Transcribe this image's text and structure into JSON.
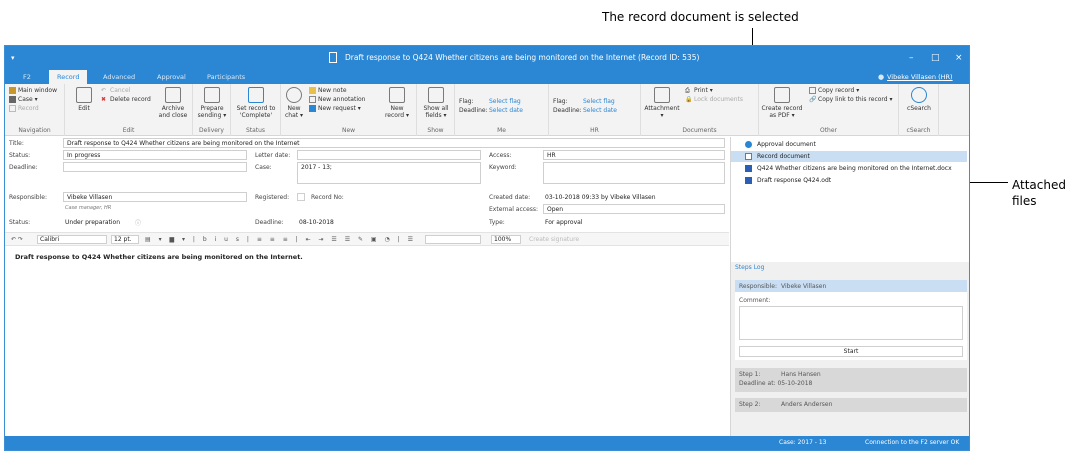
{
  "annotations": {
    "top": "The record document is selected",
    "right_line1": "Attached",
    "right_line2": "files"
  },
  "window": {
    "title": "Draft response to Q424 Whether citizens are being monitored on the Internet (Record ID: 535)",
    "minimize": "–",
    "maximize": "□",
    "close": "×"
  },
  "tabs": [
    "F2",
    "Record",
    "Advanced",
    "Approval",
    "Participants"
  ],
  "active_tab": "Record",
  "user": "Vibeke Villasen (HR)",
  "ribbon": {
    "navigation": {
      "main_window": "Main window",
      "case": "Case ▾",
      "record": "Record",
      "label": "Navigation"
    },
    "edit": {
      "edit": "Edit",
      "cancel": "Cancel",
      "delete_record": "Delete record",
      "archive": "Archive",
      "archive2": "and close",
      "label": "Edit"
    },
    "delivery": {
      "prepare": "Prepare",
      "prepare2": "sending ▾",
      "label": "Delivery"
    },
    "status": {
      "set": "Set record to",
      "set2": "'Complete'",
      "label": "Status"
    },
    "new": {
      "new_chat": "New",
      "new_chat2": "chat ▾",
      "new_note": "New note",
      "new_annotation": "New annotation",
      "new_request": "New request ▾",
      "new_record": "New",
      "new_record2": "record ▾",
      "label": "New"
    },
    "show": {
      "show_all": "Show all",
      "show_all2": "fields ▾",
      "label": "Show"
    },
    "me": {
      "flag": "Flag:",
      "select_flag": "Select flag",
      "deadline": "Deadline:",
      "select_date": "Select date",
      "label": "Me"
    },
    "hr": {
      "flag": "Flag:",
      "select_flag": "Select flag",
      "deadline": "Deadline:",
      "select_date": "Select date",
      "label": "HR"
    },
    "documents": {
      "attachment": "Attachment",
      "attachment2": "▾",
      "print": "Print ▾",
      "lock": "Lock documents",
      "label": "Documents"
    },
    "other": {
      "create_pdf": "Create record",
      "create_pdf2": "as PDF ▾",
      "copy_record": "Copy record ▾",
      "copy_link": "Copy link to this record ▾",
      "label": "Other"
    },
    "csearch": {
      "csearch": "cSearch",
      "label": "cSearch"
    }
  },
  "form": {
    "title_label": "Title:",
    "title_value": "Draft response to Q424 Whether citizens are being monitored on the Internet",
    "status_label": "Status:",
    "status_value": "In progress",
    "deadline_label": "Deadline:",
    "letter_date_label": "Letter date:",
    "case_label": "Case:",
    "case_value": "2017 - 13;",
    "access_label": "Access:",
    "access_value": "HR",
    "keyword_label": "Keyword:",
    "responsible_label": "Responsible:",
    "responsible_value": "Vibeke Villasen",
    "responsible_sub": "Case manager, HR",
    "registered_label": "Registered:",
    "record_no_label": "Record No:",
    "created_label": "Created date:",
    "created_value": "03-10-2018 09:33  by  Vibeke Villasen",
    "external_label": "External access:",
    "external_value": "Open",
    "status2_label": "Status:",
    "status2_value": "Under preparation",
    "deadline2_label": "Deadline:",
    "deadline2_value": "08-10-2018",
    "type_label": "Type:",
    "type_value": "For approval"
  },
  "editor": {
    "font": "Calibri",
    "size": "12 pt.",
    "zoom": "100%",
    "signature": "Create signature",
    "body": "Draft response to Q424 Whether citizens are being monitored on the Internet."
  },
  "documents": [
    {
      "name": "Approval document",
      "selected": false
    },
    {
      "name": "Record document",
      "selected": true
    },
    {
      "name": "Q424 Whether citizens are being monitored on the Internet.docx",
      "selected": false
    },
    {
      "name": "Draft response Q424.odt",
      "selected": false
    }
  ],
  "workflow": {
    "tabs": "Steps  Log",
    "responsible_label": "Responsible:",
    "responsible_value": "Vibeke Villasen",
    "comment_label": "Comment:",
    "start": "Start",
    "step1_label": "Step 1:",
    "step1_name": "Hans Hansen",
    "step1_deadline": "Deadline at: 05-10-2018",
    "step2_label": "Step 2:",
    "step2_name": "Anders Andersen"
  },
  "statusbar": {
    "case": "Case: 2017 - 13",
    "connection": "Connection to the F2 server OK"
  },
  "colors": {
    "accent": "#2b86d3",
    "selected": "#c9def3"
  }
}
